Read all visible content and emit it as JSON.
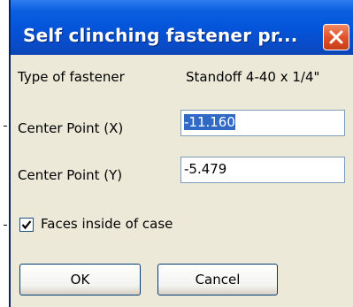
{
  "dialog": {
    "title": "Self clinching fastener pr...",
    "close_icon": "close-x-icon",
    "type_label": "Type of fastener",
    "type_value": "Standoff  4-40 x 1/4\"",
    "center_x_label": "Center Point (X)",
    "center_x_value": "-11.160",
    "center_y_label": "Center Point (Y)",
    "center_y_value": "-5.479",
    "faces_inside_label": "Faces inside of case",
    "faces_inside_checked": true,
    "ok_label": "OK",
    "cancel_label": "Cancel"
  },
  "colors": {
    "titlebar": "#0453d8",
    "close_button": "#e0522a",
    "dialog_bg": "#ece9d8",
    "selection": "#316ac5"
  }
}
